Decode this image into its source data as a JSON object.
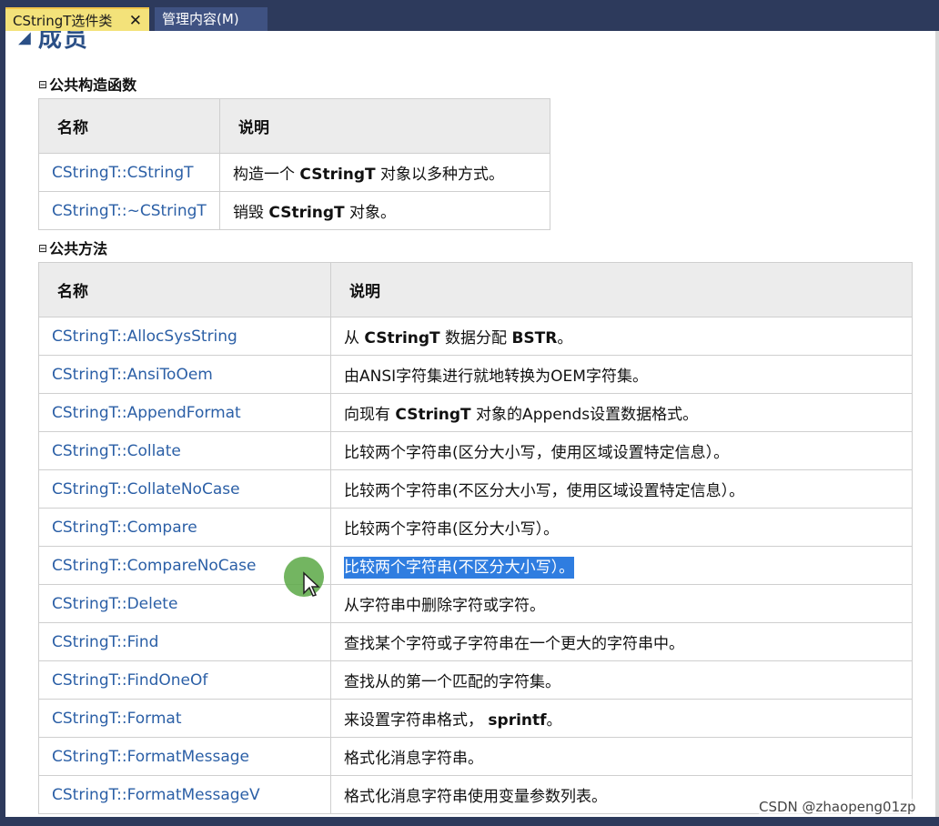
{
  "tabs": [
    {
      "label": "CStringT选件类",
      "close": "✕"
    },
    {
      "label": "管理内容(M)"
    }
  ],
  "page_heading": "成员",
  "sections": {
    "constructors": {
      "title": "公共构造函数",
      "toggle": "⊟",
      "headers": {
        "name": "名称",
        "desc": "说明"
      },
      "rows": [
        {
          "name": "CStringT::CStringT",
          "pre": "构造一个 ",
          "bold": "CStringT",
          "post": " 对象以多种方式。"
        },
        {
          "name": "CStringT::~CStringT",
          "pre": "销毁 ",
          "bold": "CStringT",
          "post": " 对象。"
        }
      ]
    },
    "methods": {
      "title": "公共方法",
      "toggle": "⊟",
      "headers": {
        "name": "名称",
        "desc": "说明"
      },
      "rows": [
        {
          "name": "CStringT::AllocSysString",
          "pre": "从 ",
          "bold": "CStringT",
          "post": " 数据分配 ",
          "bold2": "BSTR",
          "post2": "。"
        },
        {
          "name": "CStringT::AnsiToOem",
          "pre": "由ANSI字符集进行就地转换为OEM字符集。"
        },
        {
          "name": "CStringT::AppendFormat",
          "pre": "向现有 ",
          "bold": "CStringT",
          "post": " 对象的Appends设置数据格式。"
        },
        {
          "name": "CStringT::Collate",
          "pre": "比较两个字符串(区分大小写，使用区域设置特定信息）。"
        },
        {
          "name": "CStringT::CollateNoCase",
          "pre": "比较两个字符串(不区分大小写，使用区域设置特定信息）。"
        },
        {
          "name": "CStringT::Compare",
          "pre": "比较两个字符串(区分大小写）。"
        },
        {
          "name": "CStringT::CompareNoCase",
          "highlight": "比较两个字符串(不区分大小写）。"
        },
        {
          "name": "CStringT::Delete",
          "pre": "从字符串中删除字符或字符。"
        },
        {
          "name": "CStringT::Find",
          "pre": "查找某个字符或子字符串在一个更大的字符串中。"
        },
        {
          "name": "CStringT::FindOneOf",
          "pre": "查找从的第一个匹配的字符集。"
        },
        {
          "name": "CStringT::Format",
          "pre": "来设置字符串格式， ",
          "bold": "sprintf",
          "post": "。"
        },
        {
          "name": "CStringT::FormatMessage",
          "pre": "格式化消息字符串。"
        },
        {
          "name": "CStringT::FormatMessageV",
          "pre": "格式化消息字符串使用变量参数列表。"
        }
      ]
    }
  },
  "watermark": "CSDN @zhaopeng01zp",
  "colors": {
    "link": "#2b5fa6",
    "selection": "#2f7de0",
    "tab_active": "#f3e27a"
  }
}
